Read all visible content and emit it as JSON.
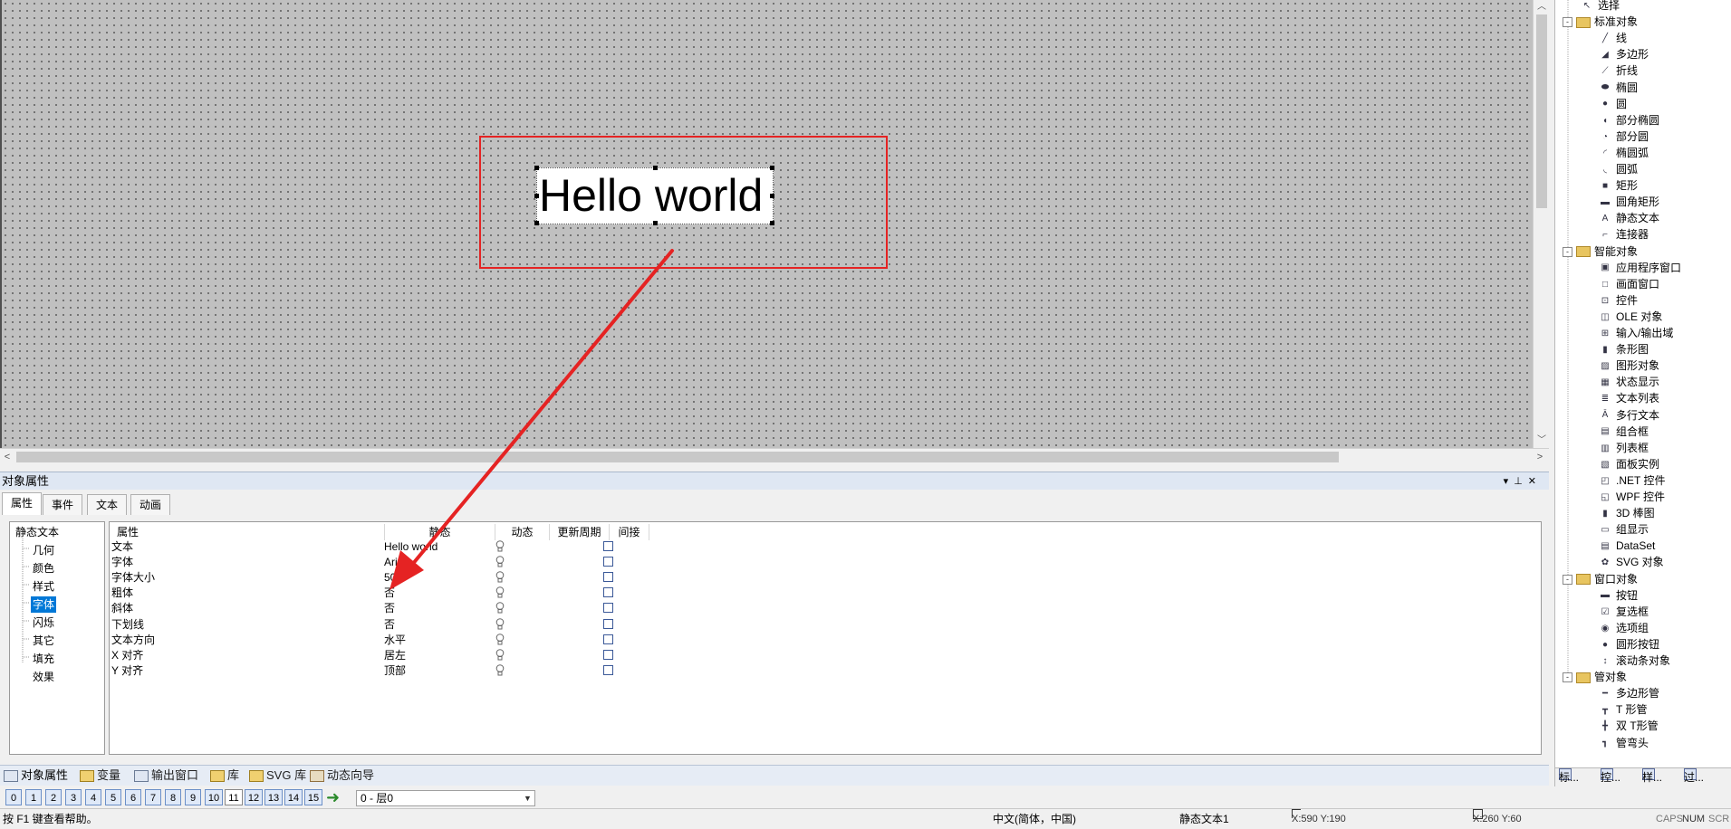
{
  "canvas": {
    "text_object": "Hello world"
  },
  "toolbox": {
    "items": [
      {
        "label": "选择",
        "icon": "pointer-icon",
        "level": 1
      },
      {
        "label": "标准对象",
        "icon": "folder-icon",
        "level": 0,
        "expander": "-"
      },
      {
        "label": "线",
        "icon": "line-icon",
        "level": 1
      },
      {
        "label": "多边形",
        "icon": "polygon-icon",
        "level": 1
      },
      {
        "label": "折线",
        "icon": "polyline-icon",
        "level": 1
      },
      {
        "label": "椭圆",
        "icon": "ellipse-icon",
        "level": 1
      },
      {
        "label": "圆",
        "icon": "circle-icon",
        "level": 1
      },
      {
        "label": "部分椭圆",
        "icon": "partial-ellipse-icon",
        "level": 1
      },
      {
        "label": "部分圆",
        "icon": "partial-circle-icon",
        "level": 1
      },
      {
        "label": "椭圆弧",
        "icon": "ellipse-arc-icon",
        "level": 1
      },
      {
        "label": "圆弧",
        "icon": "arc-icon",
        "level": 1
      },
      {
        "label": "矩形",
        "icon": "rectangle-icon",
        "level": 1
      },
      {
        "label": "圆角矩形",
        "icon": "rounded-rectangle-icon",
        "level": 1
      },
      {
        "label": "静态文本",
        "icon": "text-icon",
        "level": 1
      },
      {
        "label": "连接器",
        "icon": "connector-icon",
        "level": 1
      },
      {
        "label": "智能对象",
        "icon": "folder-icon",
        "level": 0,
        "expander": "-"
      },
      {
        "label": "应用程序窗口",
        "icon": "app-window-icon",
        "level": 1
      },
      {
        "label": "画面窗口",
        "icon": "screen-window-icon",
        "level": 1
      },
      {
        "label": "控件",
        "icon": "control-icon",
        "level": 1
      },
      {
        "label": "OLE 对象",
        "icon": "ole-icon",
        "level": 1
      },
      {
        "label": "输入/输出域",
        "icon": "io-field-icon",
        "level": 1
      },
      {
        "label": "条形图",
        "icon": "bar-icon",
        "level": 1
      },
      {
        "label": "图形对象",
        "icon": "graphic-icon",
        "level": 1
      },
      {
        "label": "状态显示",
        "icon": "status-icon",
        "level": 1
      },
      {
        "label": "文本列表",
        "icon": "text-list-icon",
        "level": 1
      },
      {
        "label": "多行文本",
        "icon": "multiline-text-icon",
        "level": 1
      },
      {
        "label": "组合框",
        "icon": "combobox-icon",
        "level": 1
      },
      {
        "label": "列表框",
        "icon": "listbox-icon",
        "level": 1
      },
      {
        "label": "面板实例",
        "icon": "panel-icon",
        "level": 1
      },
      {
        "label": ".NET 控件",
        "icon": "dotnet-icon",
        "level": 1
      },
      {
        "label": "WPF 控件",
        "icon": "wpf-icon",
        "level": 1
      },
      {
        "label": "3D 棒图",
        "icon": "3d-bar-icon",
        "level": 1
      },
      {
        "label": "组显示",
        "icon": "group-display-icon",
        "level": 1
      },
      {
        "label": "DataSet",
        "icon": "dataset-icon",
        "level": 1
      },
      {
        "label": "SVG 对象",
        "icon": "svg-icon",
        "level": 1
      },
      {
        "label": "窗口对象",
        "icon": "folder-icon",
        "level": 0,
        "expander": "-"
      },
      {
        "label": "按钮",
        "icon": "button-icon",
        "level": 1
      },
      {
        "label": "复选框",
        "icon": "checkbox-icon",
        "level": 1
      },
      {
        "label": "选项组",
        "icon": "option-group-icon",
        "level": 1
      },
      {
        "label": "圆形按钮",
        "icon": "round-button-icon",
        "level": 1
      },
      {
        "label": "滚动条对象",
        "icon": "scrollbar-icon",
        "level": 1
      },
      {
        "label": "管对象",
        "icon": "folder-icon",
        "level": 0,
        "expander": "-"
      },
      {
        "label": "多边形管",
        "icon": "polygon-pipe-icon",
        "level": 1
      },
      {
        "label": "T 形管",
        "icon": "t-pipe-icon",
        "level": 1
      },
      {
        "label": "双 T形管",
        "icon": "double-t-pipe-icon",
        "level": 1
      },
      {
        "label": "管弯头",
        "icon": "elbow-pipe-icon",
        "level": 1
      }
    ],
    "tabs": [
      "标...",
      "控...",
      "样...",
      "过..."
    ]
  },
  "properties": {
    "title": "对象属性",
    "tabs": [
      "属性",
      "事件",
      "文本",
      "动画"
    ],
    "tree_root": "静态文本",
    "tree_items": [
      "几何",
      "颜色",
      "样式",
      "字体",
      "闪烁",
      "其它",
      "填充",
      "效果"
    ],
    "selected_tree_item": "字体",
    "columns": [
      "属性",
      "静态",
      "动态",
      "更新周期",
      "间接"
    ],
    "rows": [
      {
        "name": "文本",
        "value": "Hello world"
      },
      {
        "name": "字体",
        "value": "Arial"
      },
      {
        "name": "字体大小",
        "value": "50"
      },
      {
        "name": "粗体",
        "value": "否"
      },
      {
        "name": "斜体",
        "value": "否"
      },
      {
        "name": "下划线",
        "value": "否"
      },
      {
        "name": "文本方向",
        "value": "水平"
      },
      {
        "name": "X 对齐",
        "value": "居左"
      },
      {
        "name": "Y 对齐",
        "value": "顶部"
      }
    ]
  },
  "bottom_tabs": [
    "对象属性",
    "变量",
    "输出窗口",
    "库",
    "SVG 库",
    "动态向导"
  ],
  "layers": {
    "buttons": [
      "0",
      "1",
      "2",
      "3",
      "4",
      "5",
      "6",
      "7",
      "8",
      "9",
      "10",
      "11",
      "12",
      "13",
      "14",
      "15"
    ],
    "selected": "11",
    "current_layer": "0 - 层0"
  },
  "status": {
    "help": "按 F1 键查看帮助。",
    "language": "中文(简体，中国)",
    "object_type": "静态文本1",
    "position": "X:590 Y:190",
    "size": "X:260 Y:60",
    "caps": "CAPS",
    "num": "NUM",
    "scrl": "SCR"
  },
  "colors": {
    "annotation_red": "#e52323",
    "selection_blue": "#0078d7"
  }
}
